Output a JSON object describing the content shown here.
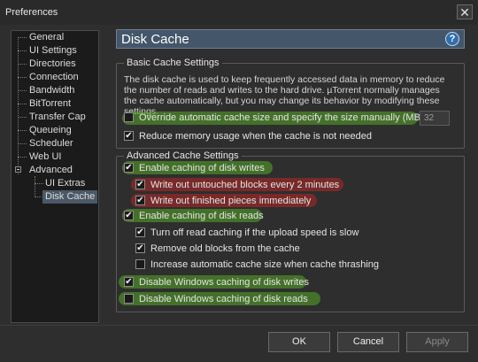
{
  "window": {
    "title": "Preferences",
    "close_glyph": "✕"
  },
  "tree": {
    "items": [
      {
        "label": "General"
      },
      {
        "label": "UI Settings"
      },
      {
        "label": "Directories"
      },
      {
        "label": "Connection"
      },
      {
        "label": "Bandwidth"
      },
      {
        "label": "BitTorrent"
      },
      {
        "label": "Transfer Cap"
      },
      {
        "label": "Queueing"
      },
      {
        "label": "Scheduler"
      },
      {
        "label": "Web UI"
      },
      {
        "label": "Advanced"
      }
    ],
    "children": [
      {
        "label": "UI Extras"
      },
      {
        "label": "Disk Cache"
      }
    ],
    "selected": "Disk Cache"
  },
  "header": {
    "title": "Disk Cache",
    "help_glyph": "?"
  },
  "basic": {
    "title": "Basic Cache Settings",
    "description": "The disk cache is used to keep frequently accessed data in memory to reduce the number of reads and writes to the hard drive. µTorrent normally manages the cache automatically, but you may change its behavior by modifying these settings.",
    "override": {
      "label": "Override automatic cache size and specify the size manually (MB)",
      "checked": false
    },
    "size_value": "32",
    "reduce": {
      "label": "Reduce memory usage when the cache is not needed",
      "checked": true
    }
  },
  "advanced": {
    "title": "Advanced Cache Settings",
    "options": [
      {
        "label": "Enable caching of disk writes",
        "checked": true
      },
      {
        "label": "Write out untouched blocks every 2 minutes",
        "checked": true
      },
      {
        "label": "Write out finished pieces immediately",
        "checked": true
      },
      {
        "label": "Enable caching of disk reads",
        "checked": true
      },
      {
        "label": "Turn off read caching if the upload speed is slow",
        "checked": true
      },
      {
        "label": "Remove old blocks from the cache",
        "checked": true
      },
      {
        "label": "Increase automatic cache size when cache thrashing",
        "checked": false
      },
      {
        "label": "Disable Windows caching of disk writes",
        "checked": true
      },
      {
        "label": "Disable Windows caching of disk reads",
        "checked": false
      }
    ]
  },
  "buttons": {
    "ok": "OK",
    "cancel": "Cancel",
    "apply": "Apply"
  },
  "colors": {
    "highlight_green": "#58aa28",
    "highlight_red": "#aa2828",
    "header_bg": "#44566a",
    "selection_bg": "#4a5968"
  },
  "icons": {
    "help": "help-icon",
    "close": "close-icon",
    "expander": "collapse-icon"
  }
}
